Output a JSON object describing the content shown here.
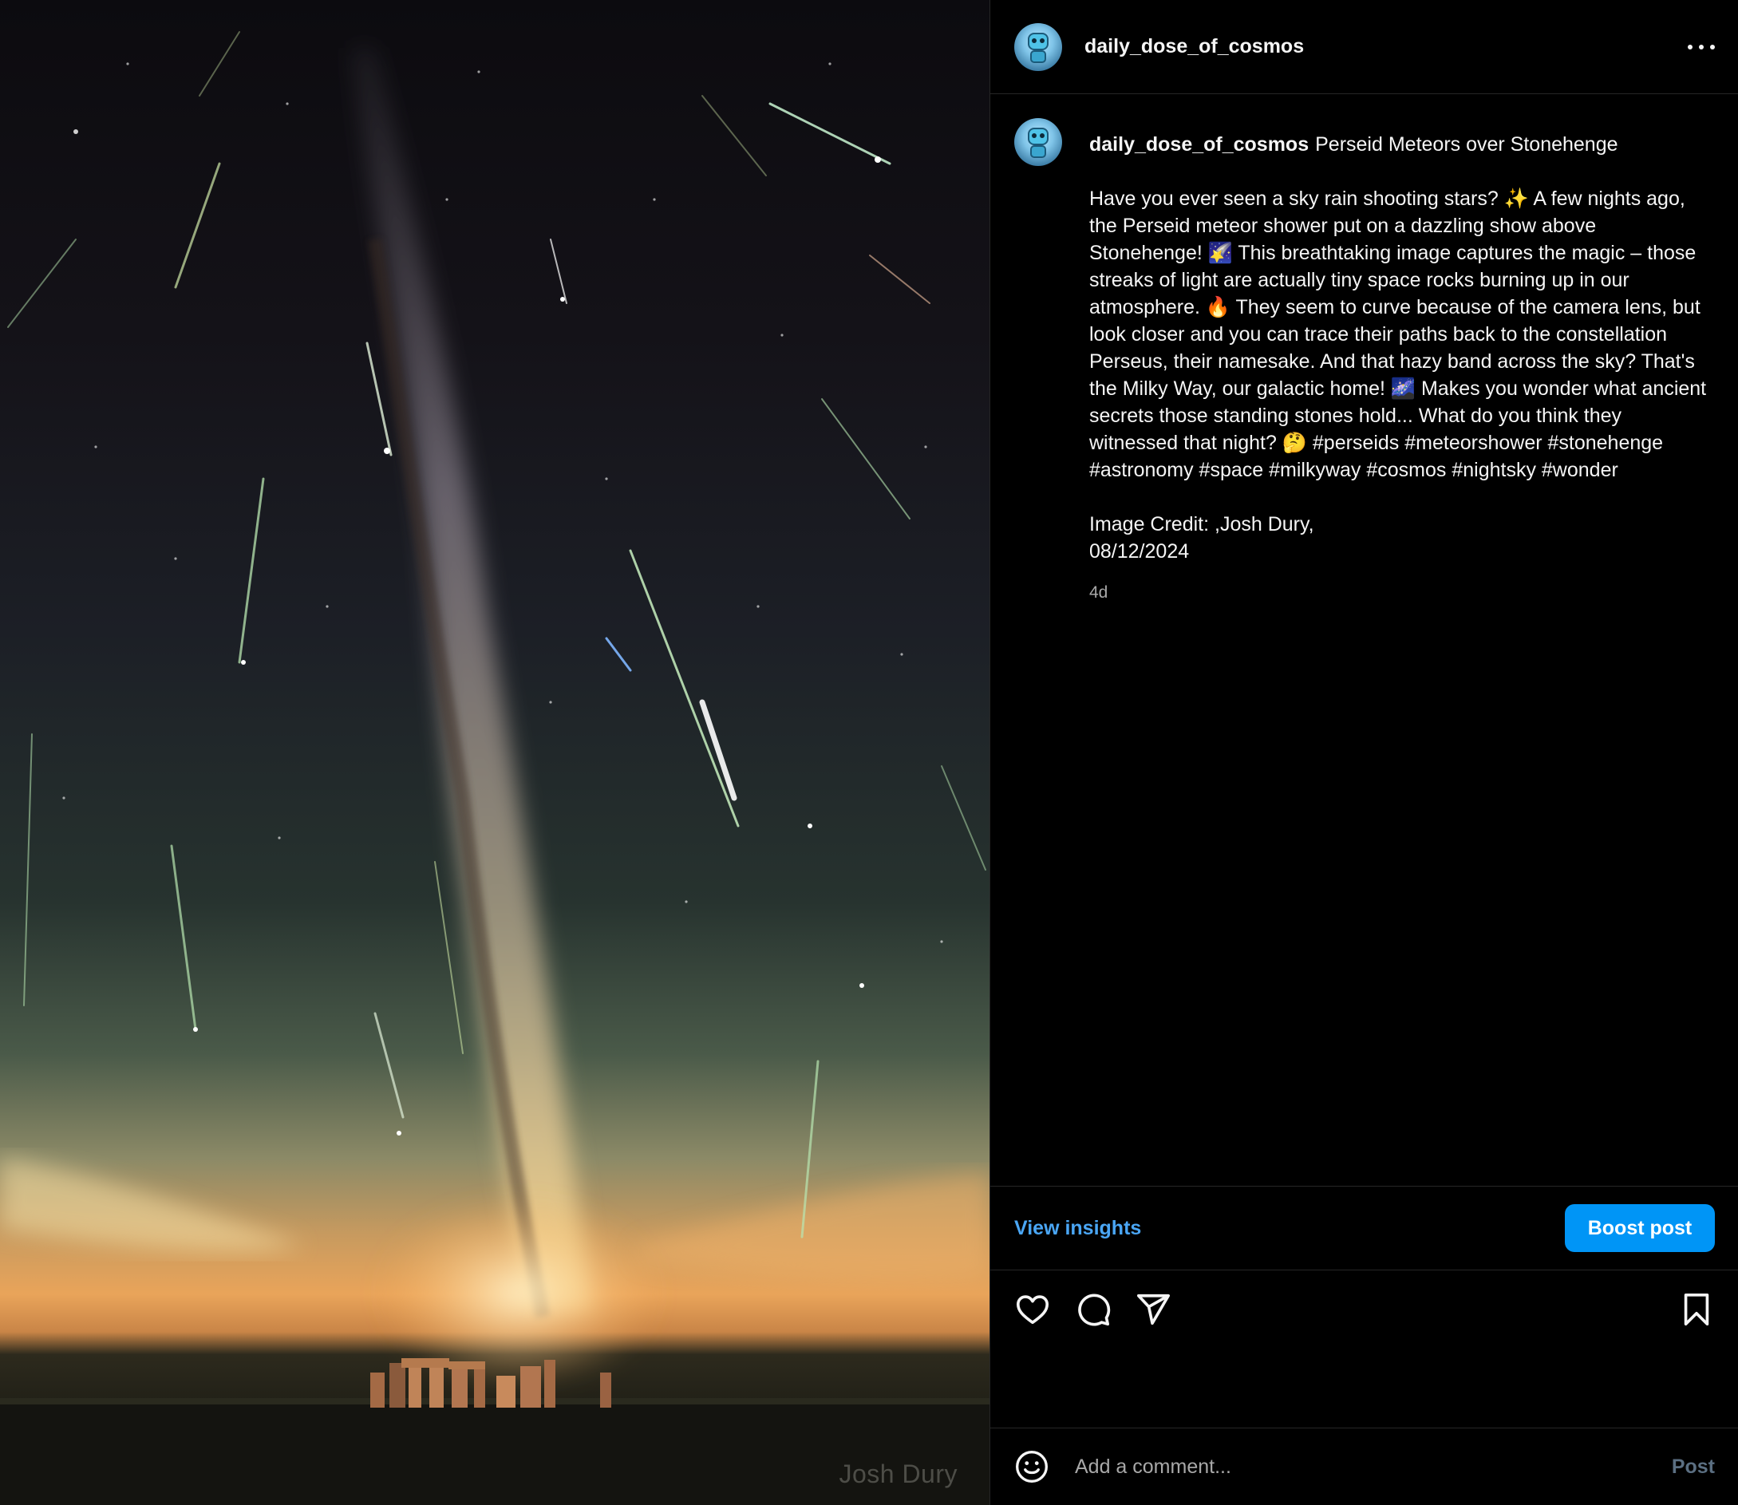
{
  "post": {
    "username": "daily_dose_of_cosmos",
    "title": "Perseid Meteors over Stonehenge",
    "body": "Have you ever seen a sky rain shooting stars? ✨ A few nights ago, the Perseid meteor shower put on a dazzling show above Stonehenge! 🌠 This breathtaking image captures the magic – those streaks of light are actually tiny space rocks burning up in our atmosphere. 🔥 They seem to curve because of the camera lens, but look closer and you can trace their paths back to the constellation Perseus, their namesake. And that hazy band across the sky? That's the Milky Way, our galactic home! 🌌 Makes you wonder what ancient secrets those standing stones hold... What do you think they witnessed that night? 🤔 #perseids #meteorshower #stonehenge #astronomy #space #milkyway #cosmos #nightsky #wonder",
    "credit_line1": "Image Credit: ,Josh Dury,",
    "credit_line2": "08/12/2024",
    "time_ago": "4d"
  },
  "photo": {
    "watermark": "Josh Dury"
  },
  "insights": {
    "view_label": "View insights",
    "boost_label": "Boost post"
  },
  "actions": {
    "icons": [
      "heart-icon",
      "comment-icon",
      "share-icon",
      "bookmark-icon"
    ]
  },
  "comment": {
    "placeholder": "Add a comment...",
    "post_label": "Post"
  },
  "colors": {
    "link_blue": "#4aa6f5",
    "boost_blue": "#0095f6",
    "divider": "#262626",
    "muted_text": "#a8a8a8"
  }
}
